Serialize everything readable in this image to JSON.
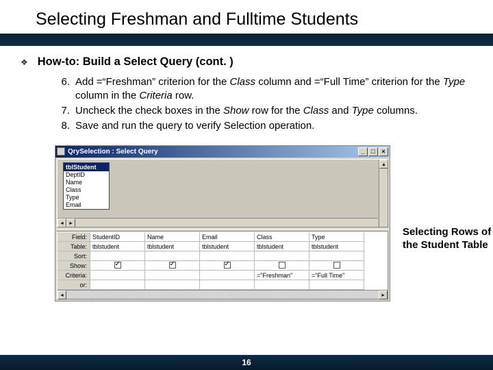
{
  "title": "Selecting Freshman and Fulltime Students",
  "subtitle": "How-to: Build a Select Query (cont. )",
  "steps": [
    {
      "n": "6.",
      "html": "Add =“Freshman” criterion for the <em>Class</em> column and =“Full Time” criterion for the <em>Type</em> column in the <em>Criteria</em> row."
    },
    {
      "n": "7.",
      "html": "Uncheck the check boxes in the <em>Show</em> row for the <em>Class</em> and <em>Type</em> columns."
    },
    {
      "n": "8.",
      "html": "Save and run the query to verify Selection operation."
    }
  ],
  "caption": "Selecting Rows of the Student Table",
  "window": {
    "title": "QrySelection : Select Query",
    "table_name": "tblStudent",
    "fields": [
      "DeptID",
      "Name",
      "Class",
      "Type",
      "Email"
    ]
  },
  "grid": {
    "row_labels": [
      "Field:",
      "Table:",
      "Sort:",
      "Show:",
      "Criteria:",
      "or:"
    ],
    "columns": [
      {
        "field": "StudentID",
        "table": "tblstudent",
        "show": true,
        "criteria": ""
      },
      {
        "field": "Name",
        "table": "tblstudent",
        "show": true,
        "criteria": ""
      },
      {
        "field": "Email",
        "table": "tblstudent",
        "show": true,
        "criteria": ""
      },
      {
        "field": "Class",
        "table": "tblstudent",
        "show": false,
        "criteria": "=\"Freshman\""
      },
      {
        "field": "Type",
        "table": "tblstudent",
        "show": false,
        "criteria": "=\"Full Time\""
      }
    ]
  },
  "page_number": "16"
}
